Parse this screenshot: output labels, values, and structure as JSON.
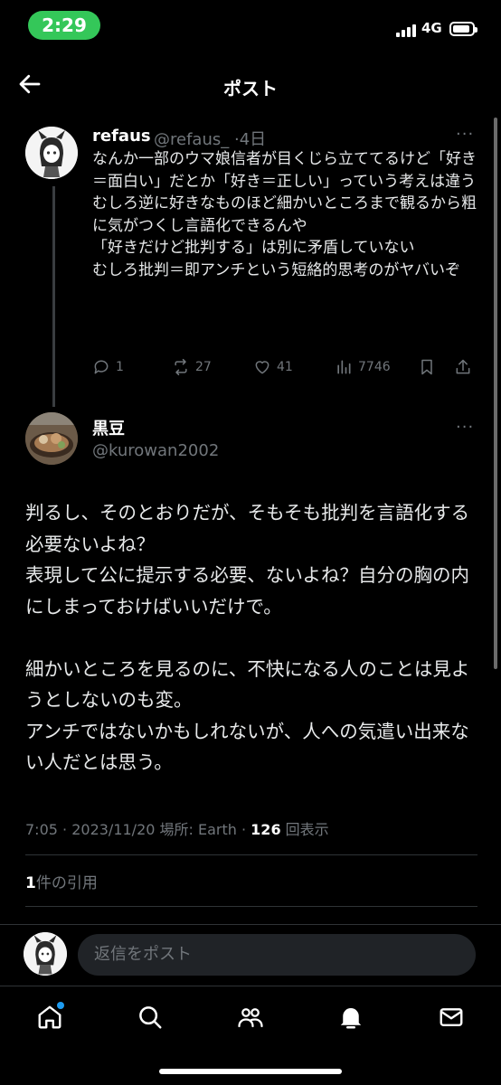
{
  "status_bar": {
    "time": "2:29",
    "network": "4G"
  },
  "header": {
    "title": "ポスト"
  },
  "parent_post": {
    "author_name": "refaus",
    "author_handle": "@refaus_",
    "age": "4日",
    "body": "なんか一部のウマ娘信者が目くじら立ててるけど「好き＝面白い」だとか「好き＝正しい」っていう考えは違う\nむしろ逆に好きなものほど細かいところまで観るから粗に気がつくし言語化できるんや\n「好きだけど批判する」は別に矛盾していない\nむしろ批判＝即アンチという短絡的思考のがヤバいぞ",
    "reply_count": "1",
    "repost_count": "27",
    "like_count": "41",
    "view_count": "7746"
  },
  "main_post": {
    "author_name": "黒豆",
    "author_handle": "@kurowan2002",
    "body": "判るし、そのとおりだが、そもそも批判を言語化する必要ないよね？\n表現して公に提示する必要、ないよね？自分の胸の内にしまっておけばいいだけで。\n\n細かいところを見るのに、不快になる人のことは見ようとしないのも変。\nアンチではないかもしれないが、人への気遣い出来ない人だとは思う。",
    "time": "7:05",
    "date": "2023/11/20",
    "location_label": "場所: Earth",
    "views_count": "126",
    "views_label": "回表示",
    "quote_count": "1",
    "quote_label": "件の引用"
  },
  "reply_bar": {
    "placeholder": "返信をポスト"
  },
  "colors": {
    "accent": "#1d9bf0",
    "time_pill": "#34c759",
    "secondary_text": "#71767b"
  }
}
